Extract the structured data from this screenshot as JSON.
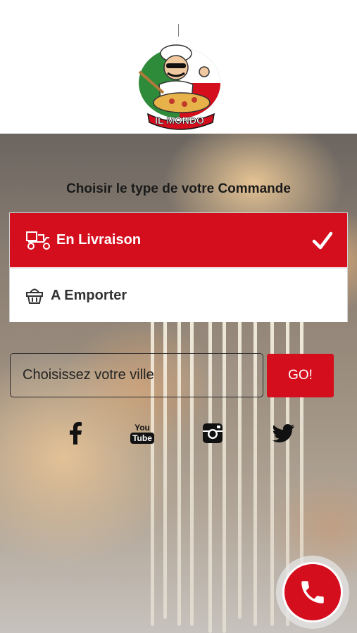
{
  "logo": {
    "text": "IL MONDO",
    "icon": "chef-pizza-logo"
  },
  "heading": "Choisir le type de votre Commande",
  "order_types": [
    {
      "label": "En Livraison",
      "icon": "delivery-scooter-icon",
      "selected": true
    },
    {
      "label": "A Emporter",
      "icon": "basket-icon",
      "selected": false
    }
  ],
  "city": {
    "placeholder": "Choisissez votre ville",
    "value": ""
  },
  "go_label": "GO!",
  "social": [
    {
      "name": "facebook",
      "icon": "facebook-icon"
    },
    {
      "name": "youtube",
      "icon": "youtube-icon",
      "text_top": "You",
      "text_bottom": "Tube"
    },
    {
      "name": "instagram",
      "icon": "instagram-icon"
    },
    {
      "name": "twitter",
      "icon": "twitter-icon"
    }
  ],
  "call_icon": "phone-icon",
  "colors": {
    "accent": "#d50e1e",
    "text": "#1a1a1a",
    "white": "#ffffff"
  }
}
